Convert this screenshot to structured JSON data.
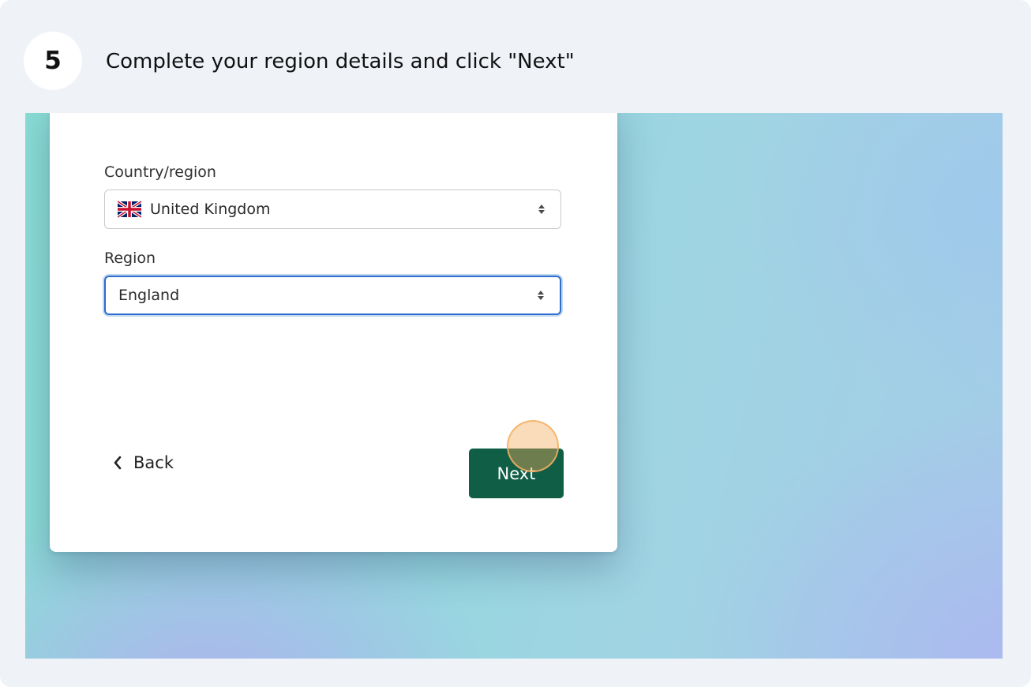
{
  "step": {
    "number": "5",
    "title": "Complete your region details and click \"Next\""
  },
  "form": {
    "country": {
      "label": "Country/region",
      "value": "United Kingdom",
      "flag_icon": "uk-flag-icon"
    },
    "region": {
      "label": "Region",
      "value": "England"
    },
    "back_label": "Back",
    "next_label": "Next"
  },
  "colors": {
    "next_button": "#0f5e45",
    "focus_ring": "#2c6ecb",
    "click_marker": "#f4aa5a"
  }
}
